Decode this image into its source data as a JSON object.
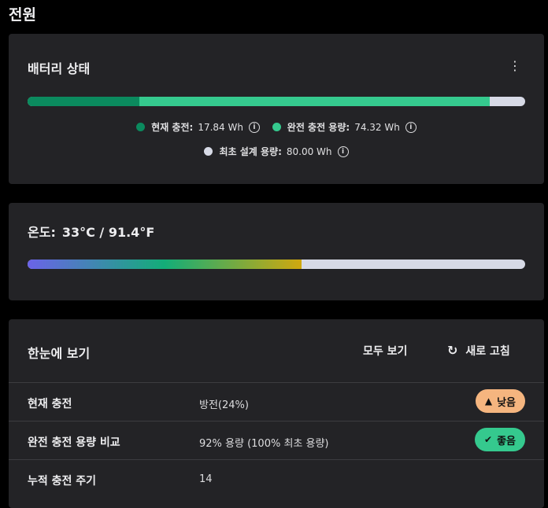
{
  "page": {
    "title": "전원"
  },
  "battery": {
    "title": "배터리 상태",
    "menu_icon": "more-vert-icon",
    "bar": {
      "current_fraction": 0.224,
      "full_fraction": 0.929,
      "current_color": "#0b8a5e",
      "full_color": "#35c98e",
      "design_color": "#d7dae6"
    },
    "legend": [
      {
        "label": "현재 충전:",
        "value": "17.84 Wh",
        "color": "#0b8a5e"
      },
      {
        "label": "완전 충전 용량:",
        "value": "74.32 Wh",
        "color": "#35c98e"
      },
      {
        "label": "최초 설계 용량:",
        "value": "80.00 Wh",
        "color": "#d7dae6"
      }
    ]
  },
  "temperature": {
    "label": "온도:",
    "value": "33°C / 91.4°F",
    "level_fraction": 0.55,
    "gradient_colors": [
      "#6b63e8",
      "#13ad78",
      "#d0a80f"
    ],
    "track_color": "#d7dae6"
  },
  "glance": {
    "title": "한눈에 보기",
    "view_all": "모두 보기",
    "refresh": "새로 고침",
    "rows": [
      {
        "label": "현재 충전",
        "value": "방전(24%)",
        "badge": {
          "text": "낮음",
          "icon": "warning-icon",
          "color": "#f5b57f"
        }
      },
      {
        "label": "완전 충전 용량 비교",
        "value": "92% 용량 (100% 최초 용량)",
        "badge": {
          "text": "좋음",
          "icon": "check-circle-icon",
          "color": "#35c98e"
        }
      },
      {
        "label": "누적 충전 주기",
        "value": "14"
      }
    ]
  }
}
